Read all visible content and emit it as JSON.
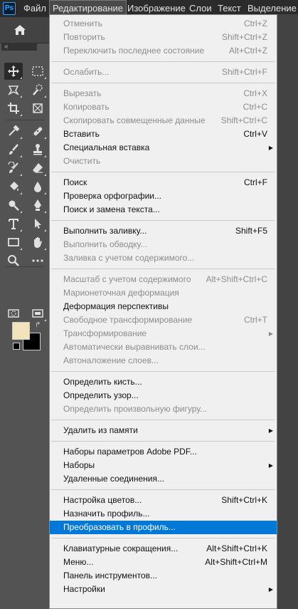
{
  "app": {
    "logo": "Ps"
  },
  "menubar": {
    "items": [
      {
        "label": "Файл"
      },
      {
        "label": "Редактирование"
      },
      {
        "label": "Изображение"
      },
      {
        "label": "Слои"
      },
      {
        "label": "Текст"
      },
      {
        "label": "Выделение"
      }
    ]
  },
  "panel_toggle": "«",
  "toolbox": {
    "tools": [
      "move-icon",
      "marquee-icon",
      "lasso-icon",
      "quick-select-icon",
      "crop-icon",
      "frame-icon",
      "eyedropper-icon",
      "healing-brush-icon",
      "brush-icon",
      "clone-stamp-icon",
      "history-brush-icon",
      "eraser-icon",
      "paint-bucket-icon",
      "blur-icon",
      "dodge-icon",
      "pen-icon",
      "type-icon",
      "path-select-icon",
      "rectangle-icon",
      "hand-icon",
      "zoom-icon",
      "more-tools-icon"
    ],
    "foreground_color": "#f2e3bd",
    "background_color": "#000000"
  },
  "edit_menu": {
    "groups": [
      [
        {
          "label": "Отменить",
          "shortcut": "Ctrl+Z",
          "disabled": true
        },
        {
          "label": "Повторить",
          "shortcut": "Shift+Ctrl+Z",
          "disabled": true
        },
        {
          "label": "Переключить последнее состояние",
          "shortcut": "Alt+Ctrl+Z",
          "disabled": true
        }
      ],
      [
        {
          "label": "Ослабить...",
          "shortcut": "Shift+Ctrl+F",
          "disabled": true
        }
      ],
      [
        {
          "label": "Вырезать",
          "shortcut": "Ctrl+X",
          "disabled": true
        },
        {
          "label": "Копировать",
          "shortcut": "Ctrl+C",
          "disabled": true
        },
        {
          "label": "Скопировать совмещенные данные",
          "shortcut": "Shift+Ctrl+C",
          "disabled": true
        },
        {
          "label": "Вставить",
          "shortcut": "Ctrl+V",
          "disabled": false
        },
        {
          "label": "Специальная вставка",
          "shortcut": "",
          "disabled": false,
          "submenu": true
        },
        {
          "label": "Очистить",
          "shortcut": "",
          "disabled": true
        }
      ],
      [
        {
          "label": "Поиск",
          "shortcut": "Ctrl+F",
          "disabled": false
        },
        {
          "label": "Проверка орфографии...",
          "shortcut": "",
          "disabled": false
        },
        {
          "label": "Поиск и замена текста...",
          "shortcut": "",
          "disabled": false
        }
      ],
      [
        {
          "label": "Выполнить заливку...",
          "shortcut": "Shift+F5",
          "disabled": false
        },
        {
          "label": "Выполнить обводку...",
          "shortcut": "",
          "disabled": true
        },
        {
          "label": "Заливка с учетом содержимого...",
          "shortcut": "",
          "disabled": true
        }
      ],
      [
        {
          "label": "Масштаб с учетом содержимого",
          "shortcut": "Alt+Shift+Ctrl+C",
          "disabled": true
        },
        {
          "label": "Марионеточная деформация",
          "shortcut": "",
          "disabled": true
        },
        {
          "label": "Деформация перспективы",
          "shortcut": "",
          "disabled": false
        },
        {
          "label": "Свободное трансформирование",
          "shortcut": "Ctrl+T",
          "disabled": true
        },
        {
          "label": "Трансформирование",
          "shortcut": "",
          "disabled": true,
          "submenu": true
        },
        {
          "label": "Автоматически выравнивать слои...",
          "shortcut": "",
          "disabled": true
        },
        {
          "label": "Автоналожение слоев...",
          "shortcut": "",
          "disabled": true
        }
      ],
      [
        {
          "label": "Определить кисть...",
          "shortcut": "",
          "disabled": false
        },
        {
          "label": "Определить узор...",
          "shortcut": "",
          "disabled": false
        },
        {
          "label": "Определить произвольную фигуру...",
          "shortcut": "",
          "disabled": true
        }
      ],
      [
        {
          "label": "Удалить из памяти",
          "shortcut": "",
          "disabled": false,
          "submenu": true
        }
      ],
      [
        {
          "label": "Наборы параметров Adobe PDF...",
          "shortcut": "",
          "disabled": false
        },
        {
          "label": "Наборы",
          "shortcut": "",
          "disabled": false,
          "submenu": true
        },
        {
          "label": "Удаленные соединения...",
          "shortcut": "",
          "disabled": false
        }
      ],
      [
        {
          "label": "Настройка цветов...",
          "shortcut": "Shift+Ctrl+K",
          "disabled": false
        },
        {
          "label": "Назначить профиль...",
          "shortcut": "",
          "disabled": false
        },
        {
          "label": "Преобразовать в профиль...",
          "shortcut": "",
          "disabled": false,
          "highlighted": true
        }
      ],
      [
        {
          "label": "Клавиатурные сокращения...",
          "shortcut": "Alt+Shift+Ctrl+K",
          "disabled": false
        },
        {
          "label": "Меню...",
          "shortcut": "Alt+Shift+Ctrl+M",
          "disabled": false
        },
        {
          "label": "Панель инструментов...",
          "shortcut": "",
          "disabled": false
        },
        {
          "label": "Настройки",
          "shortcut": "",
          "disabled": false,
          "submenu": true
        }
      ]
    ]
  }
}
